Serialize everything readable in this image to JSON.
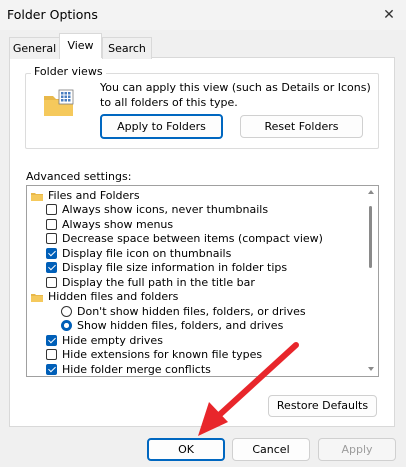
{
  "window": {
    "title": "Folder Options",
    "close_glyph": "✕"
  },
  "tabs": [
    {
      "label": "General",
      "active": false
    },
    {
      "label": "View",
      "active": true
    },
    {
      "label": "Search",
      "active": false
    }
  ],
  "folder_views": {
    "legend": "Folder views",
    "description": "You can apply this view (such as Details or Icons) to all folders of this type.",
    "apply_button": "Apply to Folders",
    "reset_button": "Reset Folders",
    "icon": "folder-views-icon"
  },
  "advanced": {
    "label": "Advanced settings:",
    "items": [
      {
        "type": "folder",
        "label": "Files and Folders"
      },
      {
        "type": "checkbox",
        "label": "Always show icons, never thumbnails",
        "checked": false
      },
      {
        "type": "checkbox",
        "label": "Always show menus",
        "checked": false
      },
      {
        "type": "checkbox",
        "label": "Decrease space between items (compact view)",
        "checked": false
      },
      {
        "type": "checkbox",
        "label": "Display file icon on thumbnails",
        "checked": true
      },
      {
        "type": "checkbox",
        "label": "Display file size information in folder tips",
        "checked": true
      },
      {
        "type": "checkbox",
        "label": "Display the full path in the title bar",
        "checked": false
      },
      {
        "type": "folder",
        "label": "Hidden files and folders"
      },
      {
        "type": "radio",
        "label": "Don't show hidden files, folders, or drives",
        "checked": false
      },
      {
        "type": "radio",
        "label": "Show hidden files, folders, and drives",
        "checked": true
      },
      {
        "type": "checkbox",
        "label": "Hide empty drives",
        "checked": true
      },
      {
        "type": "checkbox",
        "label": "Hide extensions for known file types",
        "checked": false
      },
      {
        "type": "checkbox",
        "label": "Hide folder merge conflicts",
        "checked": true
      }
    ],
    "restore_button": "Restore Defaults"
  },
  "footer": {
    "ok": "OK",
    "cancel": "Cancel",
    "apply": "Apply"
  },
  "colors": {
    "accent": "#005fb8",
    "annotation_arrow": "#e8262b"
  }
}
